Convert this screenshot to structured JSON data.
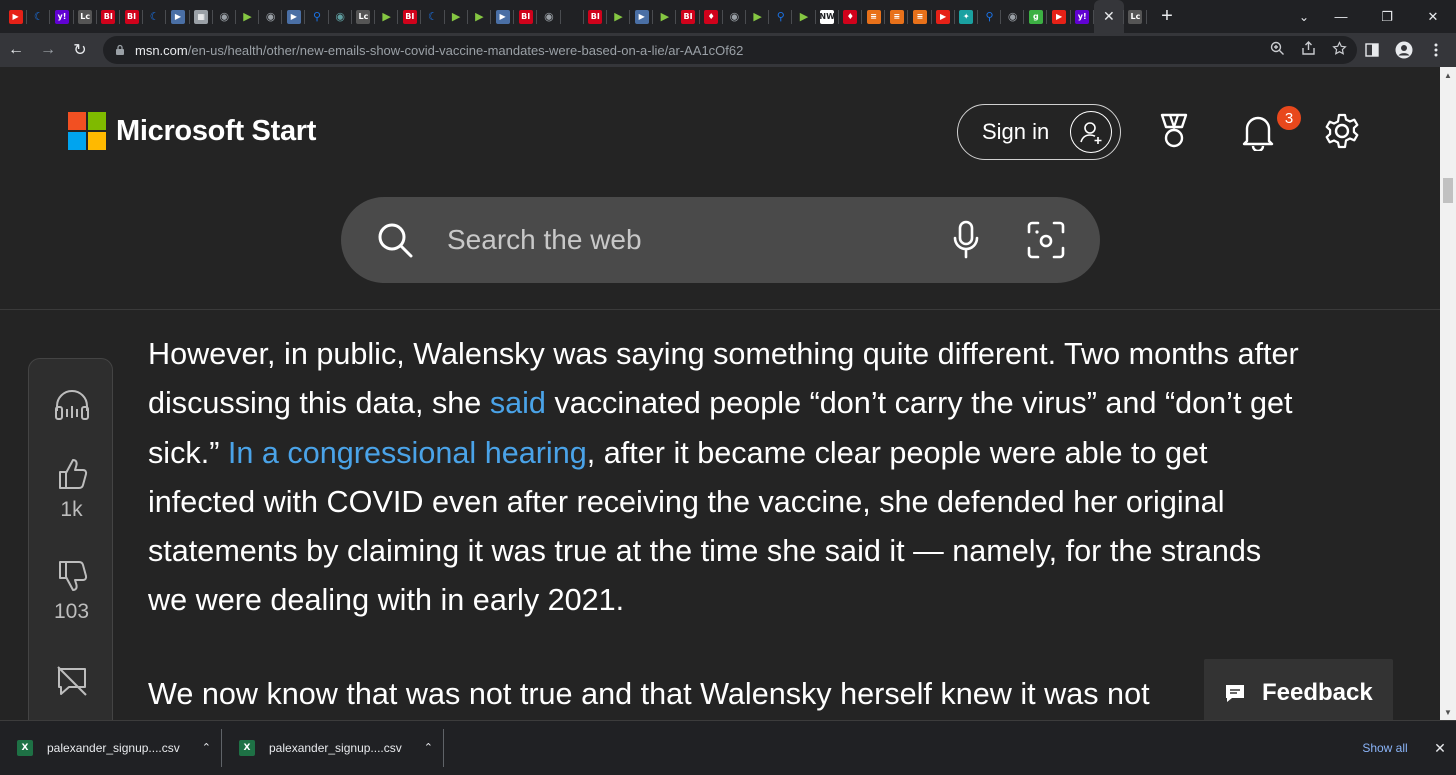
{
  "browser": {
    "tabs": [
      {
        "icon": "youtube-icon",
        "color": "#e62117",
        "glyph": "▶"
      },
      {
        "icon": "crescent-icon",
        "color": "#1a73e8",
        "glyph": "☾"
      },
      {
        "icon": "yahoo-icon",
        "color": "#6001d2",
        "glyph": "y!"
      },
      {
        "icon": "lc-icon",
        "color": "#555555",
        "glyph": "Lc"
      },
      {
        "icon": "bi-icon",
        "color": "#d0021b",
        "glyph": "BI"
      },
      {
        "icon": "bi-icon",
        "color": "#d0021b",
        "glyph": "BI"
      },
      {
        "icon": "crescent-icon",
        "color": "#1a73e8",
        "glyph": "☾"
      },
      {
        "icon": "flag-icon",
        "color": "#4a6fa5",
        "glyph": "▶"
      },
      {
        "icon": "image-icon",
        "color": "#9aa0a6",
        "glyph": "▦"
      },
      {
        "icon": "globe-icon",
        "color": "#9aa0a6",
        "glyph": "◉"
      },
      {
        "icon": "rumble-icon",
        "color": "#85c742",
        "glyph": "▶"
      },
      {
        "icon": "globe-icon",
        "color": "#9aa0a6",
        "glyph": "◉"
      },
      {
        "icon": "flag-icon",
        "color": "#4a6fa5",
        "glyph": "▶"
      },
      {
        "icon": "search-icon",
        "color": "#1a73e8",
        "glyph": "⚲"
      },
      {
        "icon": "globe-icon",
        "color": "#5f9ea0",
        "glyph": "◉"
      },
      {
        "icon": "lc-icon",
        "color": "#555555",
        "glyph": "Lc"
      },
      {
        "icon": "rumble-icon",
        "color": "#85c742",
        "glyph": "▶"
      },
      {
        "icon": "bi-icon",
        "color": "#d0021b",
        "glyph": "BI"
      },
      {
        "icon": "crescent-icon",
        "color": "#1a73e8",
        "glyph": "☾"
      },
      {
        "icon": "rumble-icon",
        "color": "#85c742",
        "glyph": "▶"
      },
      {
        "icon": "rumble-icon",
        "color": "#85c742",
        "glyph": "▶"
      },
      {
        "icon": "flag-icon",
        "color": "#4a6fa5",
        "glyph": "▶"
      },
      {
        "icon": "bi-icon",
        "color": "#d0021b",
        "glyph": "BI"
      },
      {
        "icon": "globe-icon",
        "color": "#9aa0a6",
        "glyph": "◉"
      },
      {
        "icon": "blank-icon",
        "color": "#202124",
        "glyph": ""
      },
      {
        "icon": "bi-icon",
        "color": "#d0021b",
        "glyph": "BI"
      },
      {
        "icon": "rumble-icon",
        "color": "#85c742",
        "glyph": "▶"
      },
      {
        "icon": "flag-icon",
        "color": "#4a6fa5",
        "glyph": "▶"
      },
      {
        "icon": "rumble-icon",
        "color": "#85c742",
        "glyph": "▶"
      },
      {
        "icon": "bi-icon",
        "color": "#d0021b",
        "glyph": "BI"
      },
      {
        "icon": "podcast-icon",
        "color": "#d0021b",
        "glyph": "♦"
      },
      {
        "icon": "globe-icon",
        "color": "#9aa0a6",
        "glyph": "◉"
      },
      {
        "icon": "rumble-icon",
        "color": "#85c742",
        "glyph": "▶"
      },
      {
        "icon": "search-icon",
        "color": "#1a73e8",
        "glyph": "⚲"
      },
      {
        "icon": "rumble-icon",
        "color": "#85c742",
        "glyph": "▶"
      },
      {
        "icon": "news-icon",
        "color": "#ffffff",
        "glyph": "NW"
      },
      {
        "icon": "podcast-icon",
        "color": "#d0021b",
        "glyph": "♦"
      },
      {
        "icon": "bookmark-icon",
        "color": "#e8711a",
        "glyph": "≡"
      },
      {
        "icon": "bookmark-icon",
        "color": "#e8711a",
        "glyph": "≡"
      },
      {
        "icon": "bookmark-icon",
        "color": "#e8711a",
        "glyph": "≡"
      },
      {
        "icon": "youtube-icon",
        "color": "#e62117",
        "glyph": "▶"
      },
      {
        "icon": "bird-icon",
        "color": "#1aa1a1",
        "glyph": "✦"
      },
      {
        "icon": "search-icon",
        "color": "#1a73e8",
        "glyph": "⚲"
      },
      {
        "icon": "globe-icon",
        "color": "#9aa0a6",
        "glyph": "◉"
      },
      {
        "icon": "g-icon",
        "color": "#3cb043",
        "glyph": "g"
      },
      {
        "icon": "youtube-icon",
        "color": "#e62117",
        "glyph": "▶"
      },
      {
        "icon": "yahoo-icon",
        "color": "#6001d2",
        "glyph": "y!"
      }
    ],
    "active_tab_close": "✕",
    "after_tab": {
      "icon": "lc-icon",
      "color": "#555555",
      "glyph": "Lc"
    },
    "new_tab": "+",
    "tab_dropdown": "⌄",
    "window_controls": {
      "minimize": "—",
      "restore": "❐",
      "close": "✕"
    },
    "nav": {
      "back": "←",
      "forward": "→",
      "reload": "↻"
    },
    "url": {
      "host": "msn.com",
      "path": "/en-us/health/other/new-emails-show-covid-vaccine-mandates-were-based-on-a-lie/ar-AA1cOf62"
    },
    "omnibox_icons": [
      "zoom-icon",
      "share-icon",
      "star-icon"
    ],
    "toolbar_icons": [
      "sidepanel-icon",
      "profile-icon",
      "menu-icon"
    ]
  },
  "site": {
    "brand": "Microsoft Start",
    "signin_label": "Sign in",
    "notification_count": "3",
    "search_placeholder": "Search the web"
  },
  "rail": {
    "likes": "1k",
    "dislikes": "103"
  },
  "article": {
    "p1_a": "However, in public, Walensky was saying something quite different. Two months after discussing this data, she ",
    "p1_link1": "said",
    "p1_b": " vaccinated people “don’t carry the virus” and “don’t get sick.” ",
    "p1_link2": "In a congressional hearing",
    "p1_c": ", after it became clear people were able to get infected with COVID even after receiving the vaccine, she defended her original statements by claiming it was true at the time she said it — namely, for the strands we were dealing with in early 2021.",
    "p2": "We now know that was not true and that Walensky herself knew it was not"
  },
  "feedback_label": "Feedback",
  "downloads": {
    "items": [
      {
        "name": "palexander_signup....csv"
      },
      {
        "name": "palexander_signup....csv"
      }
    ],
    "show_all": "Show all"
  },
  "colors": {
    "link": "#4aa3e8",
    "badge": "#e8481c",
    "page_bg": "#242424",
    "search_bg": "#4a4a4a"
  }
}
